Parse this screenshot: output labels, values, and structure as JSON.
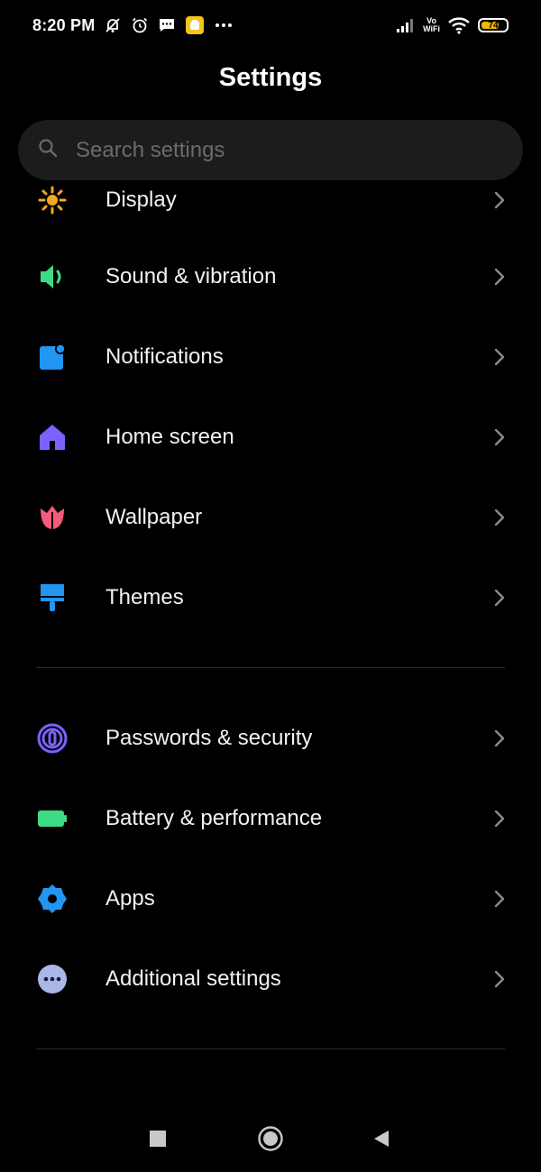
{
  "status_bar": {
    "time": "8:20 PM",
    "volte_line1": "Vo",
    "volte_line2": "WiFi",
    "battery_level": "74",
    "battery_fraction": 0.74,
    "left_icons": [
      "muted-bell-icon",
      "alarm-icon",
      "message-icon",
      "app-notification-icon",
      "more-dots-icon"
    ],
    "right_icons": [
      "signal-icon",
      "vowifi-icon",
      "wifi-icon",
      "battery-icon"
    ]
  },
  "header": {
    "title": "Settings"
  },
  "search": {
    "placeholder": "Search settings"
  },
  "list": {
    "partial_item": {
      "label": "Display",
      "icon": "sun-icon",
      "color": "#f5a623"
    },
    "group1": [
      {
        "label": "Sound & vibration",
        "icon": "speaker-icon",
        "color": "#3ddc84"
      },
      {
        "label": "Notifications",
        "icon": "notification-icon",
        "color": "#2196f3"
      },
      {
        "label": "Home screen",
        "icon": "home-icon",
        "color": "#7b61ff"
      },
      {
        "label": "Wallpaper",
        "icon": "tulip-icon",
        "color": "#f25c7a"
      },
      {
        "label": "Themes",
        "icon": "paintbrush-icon",
        "color": "#2196f3"
      }
    ],
    "group2": [
      {
        "label": "Passwords & security",
        "icon": "fingerprint-icon",
        "color": "#7b61ff"
      },
      {
        "label": "Battery & performance",
        "icon": "battery-icon",
        "color": "#3ddc84"
      },
      {
        "label": "Apps",
        "icon": "gear-icon",
        "color": "#2196f3"
      },
      {
        "label": "Additional settings",
        "icon": "more-icon",
        "color": "#a9b8e8"
      }
    ]
  },
  "nav_bar": {
    "buttons": [
      "recents-button",
      "home-button",
      "back-button"
    ]
  }
}
